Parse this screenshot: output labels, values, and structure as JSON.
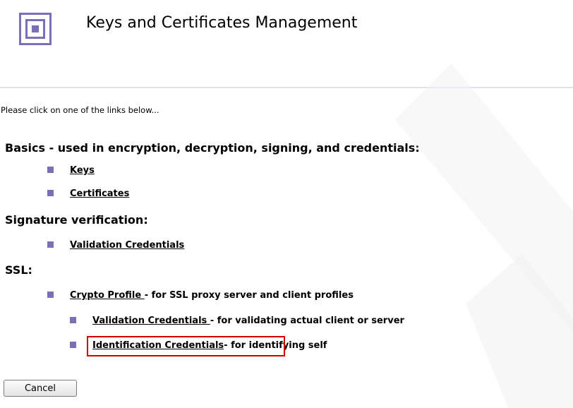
{
  "page": {
    "title": "Keys and Certificates Management",
    "instruction": "Please click on one of the links below..."
  },
  "sections": {
    "basics": {
      "heading": "Basics - used in encryption, decryption, signing, and credentials:",
      "items": [
        {
          "label": "Keys"
        },
        {
          "label": "Certificates"
        }
      ]
    },
    "signature": {
      "heading": "Signature verification:",
      "items": [
        {
          "label": "Validation Credentials"
        }
      ]
    },
    "ssl": {
      "heading": "SSL:",
      "crypto_profile": {
        "label": "Crypto Profile ",
        "desc": "- for SSL proxy server and client profiles"
      },
      "validation": {
        "label": "Validation Credentials ",
        "desc": "- for validating actual client or server"
      },
      "identification": {
        "label": "Identification Credentials",
        "desc": "- for identifying self"
      }
    }
  },
  "buttons": {
    "cancel": "Cancel"
  },
  "colors": {
    "accent": "#7a70b8",
    "highlight": "#d40000",
    "divider": "#dfe1f2"
  },
  "icons": {
    "logo": "concentric-squares-logo",
    "bullet": "square-bullet"
  }
}
